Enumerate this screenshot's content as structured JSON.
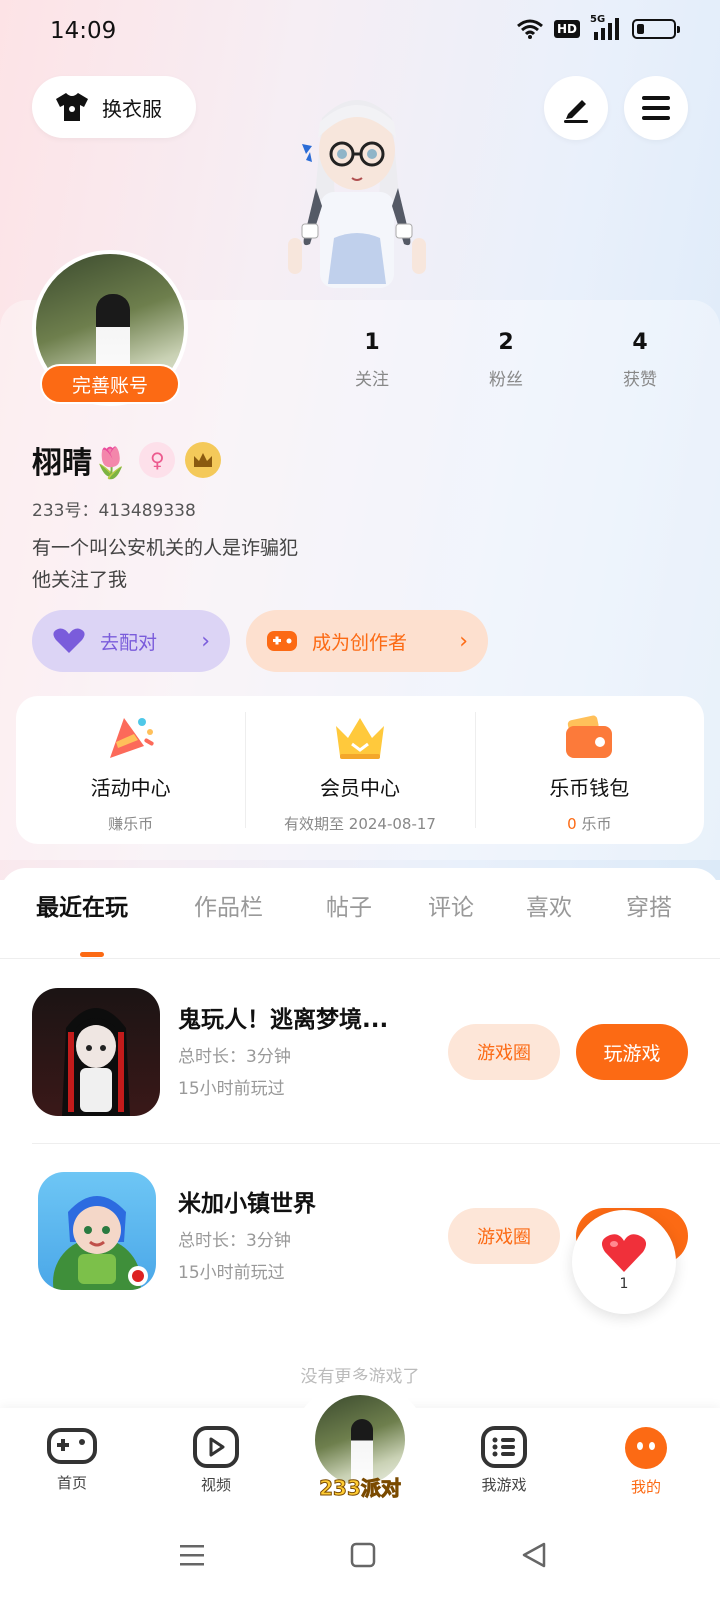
{
  "status": {
    "time": "14:09",
    "hd": "HD",
    "network": "5G"
  },
  "header": {
    "outfit_label": "换衣服"
  },
  "profile": {
    "complete_badge": "完善账号",
    "stats": [
      {
        "value": "1",
        "label": "关注"
      },
      {
        "value": "2",
        "label": "粉丝"
      },
      {
        "value": "4",
        "label": "获赞"
      }
    ],
    "name": "栩晴🌷",
    "gender_symbol": "♀",
    "uid_label": "233号：",
    "uid": "413489338",
    "bio_line1": "有一个叫公安机关的人是诈骗犯",
    "bio_line2": "他关注了我",
    "match_label": "去配对",
    "creator_label": "成为创作者"
  },
  "features": [
    {
      "title": "活动中心",
      "sub": "赚乐币"
    },
    {
      "title": "会员中心",
      "sub": "有效期至 2024-08-17"
    },
    {
      "title": "乐币钱包",
      "sub_value": "0",
      "sub": "乐币"
    }
  ],
  "tabs": [
    "最近在玩",
    "作品栏",
    "帖子",
    "评论",
    "喜欢",
    "穿搭"
  ],
  "games": [
    {
      "title": "鬼玩人！逃离梦境...",
      "duration": "总时长：3分钟",
      "last_played": "15小时前玩过",
      "circle_label": "游戏圈",
      "play_label": "玩游戏"
    },
    {
      "title": "米加小镇世界",
      "duration": "总时长：3分钟",
      "last_played": "15小时前玩过",
      "circle_label": "游戏圈",
      "play_label": "玩游戏"
    }
  ],
  "no_more": "没有更多游戏了",
  "like_count": "1",
  "nav": {
    "home": "首页",
    "video": "视频",
    "center": "233派对",
    "my_games": "我游戏",
    "mine": "我的"
  },
  "colors": {
    "accent": "#fc6a14",
    "purple": "#7a5cdb"
  }
}
